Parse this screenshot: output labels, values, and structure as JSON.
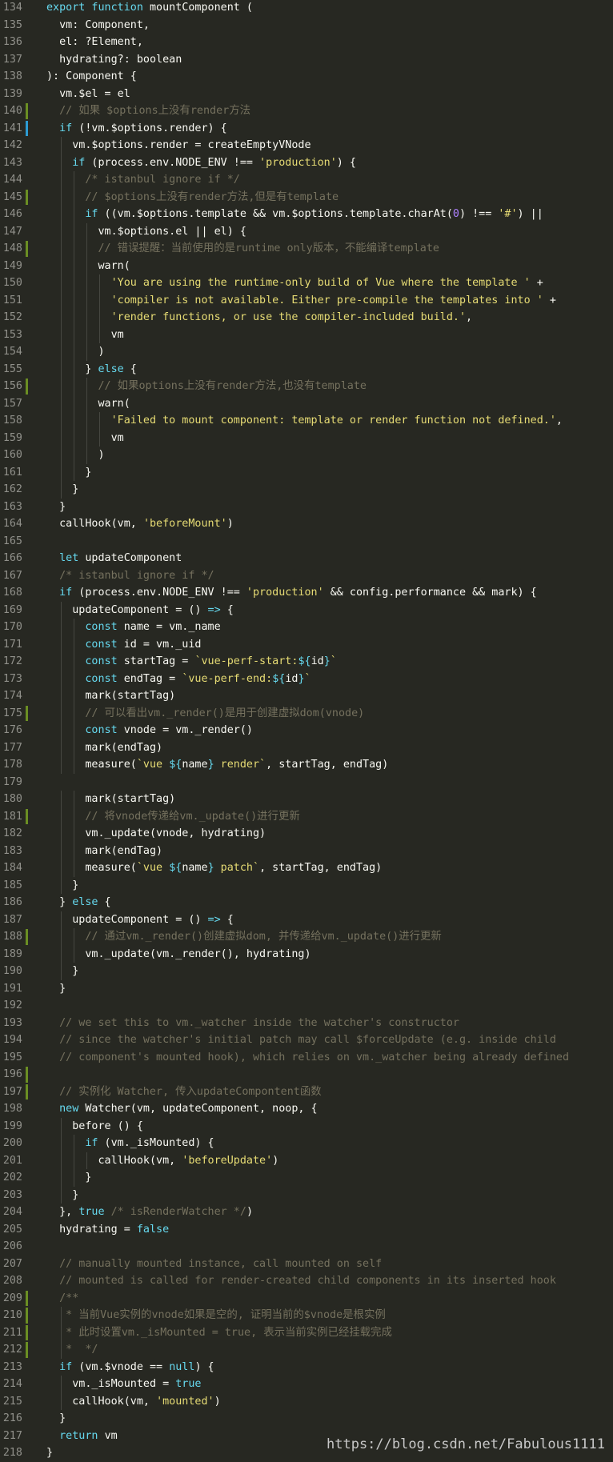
{
  "editor": {
    "background": "#272822",
    "colors": {
      "keyword": "#66d9ef",
      "string": "#e6db74",
      "comment": "#75715e",
      "number": "#ae81ff",
      "text": "#f8f8f2",
      "gutter_modified": "#6b8e23",
      "gutter_changed": "#2d9bd2"
    },
    "lines": [
      {
        "n": "134",
        "g": "",
        "t": [
          [
            "kw",
            "export function "
          ],
          [
            "",
            "mountComponent ("
          ]
        ]
      },
      {
        "n": "135",
        "g": "",
        "t": [
          [
            "",
            "  vm: Component,"
          ]
        ]
      },
      {
        "n": "136",
        "g": "",
        "t": [
          [
            "",
            "  el: ?Element,"
          ]
        ]
      },
      {
        "n": "137",
        "g": "",
        "t": [
          [
            "",
            "  hydrating?: boolean"
          ]
        ]
      },
      {
        "n": "138",
        "g": "",
        "t": [
          [
            "",
            "): Component {"
          ]
        ]
      },
      {
        "n": "139",
        "g": "",
        "t": [
          [
            "",
            "  vm.$el = el"
          ]
        ]
      },
      {
        "n": "140",
        "g": "mod",
        "t": [
          [
            "cm",
            "  // 如果 $options上没有render方法"
          ]
        ]
      },
      {
        "n": "141",
        "g": "chg",
        "t": [
          [
            "kw",
            "  if"
          ],
          [
            "",
            " (!vm.$options.render) {"
          ]
        ]
      },
      {
        "n": "142",
        "g": "",
        "t": [
          [
            "",
            "    vm.$options.render = createEmptyVNode"
          ]
        ]
      },
      {
        "n": "143",
        "g": "",
        "t": [
          [
            "kw",
            "    if"
          ],
          [
            "",
            " (process.env.NODE_ENV !== "
          ],
          [
            "str",
            "'production'"
          ],
          [
            "",
            ") {"
          ]
        ]
      },
      {
        "n": "144",
        "g": "",
        "t": [
          [
            "cm",
            "      /* istanbul ignore if */"
          ]
        ]
      },
      {
        "n": "145",
        "g": "mod",
        "t": [
          [
            "cm",
            "      // $options上没有render方法,但是有template"
          ]
        ]
      },
      {
        "n": "146",
        "g": "",
        "t": [
          [
            "kw",
            "      if"
          ],
          [
            "",
            " ((vm.$options.template && vm.$options.template.charAt("
          ],
          [
            "num",
            "0"
          ],
          [
            "",
            ") !== "
          ],
          [
            "str",
            "'#'"
          ],
          [
            "",
            ") ||"
          ]
        ]
      },
      {
        "n": "147",
        "g": "",
        "t": [
          [
            "",
            "        vm.$options.el || el) {"
          ]
        ]
      },
      {
        "n": "148",
        "g": "mod",
        "t": [
          [
            "cm",
            "        // 错误提醒：当前使用的是runtime only版本，不能编译template"
          ]
        ]
      },
      {
        "n": "149",
        "g": "",
        "t": [
          [
            "",
            "        warn("
          ]
        ]
      },
      {
        "n": "150",
        "g": "",
        "t": [
          [
            "str",
            "          'You are using the runtime-only build of Vue where the template '"
          ],
          [
            "",
            " +"
          ]
        ]
      },
      {
        "n": "151",
        "g": "",
        "t": [
          [
            "str",
            "          'compiler is not available. Either pre-compile the templates into '"
          ],
          [
            "",
            " +"
          ]
        ]
      },
      {
        "n": "152",
        "g": "",
        "t": [
          [
            "str",
            "          'render functions, or use the compiler-included build.'"
          ],
          [
            "",
            ","
          ]
        ]
      },
      {
        "n": "153",
        "g": "",
        "t": [
          [
            "",
            "          vm"
          ]
        ]
      },
      {
        "n": "154",
        "g": "",
        "t": [
          [
            "",
            "        )"
          ]
        ]
      },
      {
        "n": "155",
        "g": "",
        "t": [
          [
            "",
            "      } "
          ],
          [
            "kw",
            "else"
          ],
          [
            "",
            " {"
          ]
        ]
      },
      {
        "n": "156",
        "g": "mod",
        "t": [
          [
            "cm",
            "        // 如果options上没有render方法,也没有template"
          ]
        ]
      },
      {
        "n": "157",
        "g": "",
        "t": [
          [
            "",
            "        warn("
          ]
        ]
      },
      {
        "n": "158",
        "g": "",
        "t": [
          [
            "str",
            "          'Failed to mount component: template or render function not defined.'"
          ],
          [
            "",
            ","
          ]
        ]
      },
      {
        "n": "159",
        "g": "",
        "t": [
          [
            "",
            "          vm"
          ]
        ]
      },
      {
        "n": "160",
        "g": "",
        "t": [
          [
            "",
            "        )"
          ]
        ]
      },
      {
        "n": "161",
        "g": "",
        "t": [
          [
            "",
            "      }"
          ]
        ]
      },
      {
        "n": "162",
        "g": "",
        "t": [
          [
            "",
            "    }"
          ]
        ]
      },
      {
        "n": "163",
        "g": "",
        "t": [
          [
            "",
            "  }"
          ]
        ]
      },
      {
        "n": "164",
        "g": "",
        "t": [
          [
            "",
            "  callHook(vm, "
          ],
          [
            "str",
            "'beforeMount'"
          ],
          [
            "",
            ")"
          ]
        ]
      },
      {
        "n": "165",
        "g": "",
        "t": []
      },
      {
        "n": "166",
        "g": "",
        "t": [
          [
            "kw",
            "  let "
          ],
          [
            "",
            "updateComponent"
          ]
        ]
      },
      {
        "n": "167",
        "g": "",
        "t": [
          [
            "cm",
            "  /* istanbul ignore if */"
          ]
        ]
      },
      {
        "n": "168",
        "g": "",
        "t": [
          [
            "kw",
            "  if"
          ],
          [
            "",
            " (process.env.NODE_ENV !== "
          ],
          [
            "str",
            "'production'"
          ],
          [
            "",
            " && config.performance && mark) {"
          ]
        ]
      },
      {
        "n": "169",
        "g": "",
        "t": [
          [
            "",
            "    updateComponent = () "
          ],
          [
            "kw",
            "=>"
          ],
          [
            "",
            " {"
          ]
        ]
      },
      {
        "n": "170",
        "g": "",
        "t": [
          [
            "kw",
            "      const "
          ],
          [
            "",
            "name = vm._name"
          ]
        ]
      },
      {
        "n": "171",
        "g": "",
        "t": [
          [
            "kw",
            "      const "
          ],
          [
            "",
            "id = vm._uid"
          ]
        ]
      },
      {
        "n": "172",
        "g": "",
        "t": [
          [
            "kw",
            "      const "
          ],
          [
            "",
            "startTag = "
          ],
          [
            "str",
            "`vue-perf-start:"
          ],
          [
            "kw",
            "${"
          ],
          [
            "",
            "id"
          ],
          [
            "kw",
            "}"
          ],
          [
            "str",
            "`"
          ]
        ]
      },
      {
        "n": "173",
        "g": "",
        "t": [
          [
            "kw",
            "      const "
          ],
          [
            "",
            "endTag = "
          ],
          [
            "str",
            "`vue-perf-end:"
          ],
          [
            "kw",
            "${"
          ],
          [
            "",
            "id"
          ],
          [
            "kw",
            "}"
          ],
          [
            "str",
            "`"
          ]
        ]
      },
      {
        "n": "174",
        "g": "",
        "t": [
          [
            "",
            "      mark(startTag)"
          ]
        ]
      },
      {
        "n": "175",
        "g": "mod",
        "t": [
          [
            "cm",
            "      // 可以看出vm._render()是用于创建虚拟dom(vnode)"
          ]
        ]
      },
      {
        "n": "176",
        "g": "",
        "t": [
          [
            "kw",
            "      const "
          ],
          [
            "",
            "vnode = vm._render()"
          ]
        ]
      },
      {
        "n": "177",
        "g": "",
        "t": [
          [
            "",
            "      mark(endTag)"
          ]
        ]
      },
      {
        "n": "178",
        "g": "",
        "t": [
          [
            "",
            "      measure("
          ],
          [
            "str",
            "`vue "
          ],
          [
            "kw",
            "${"
          ],
          [
            "",
            "name"
          ],
          [
            "kw",
            "}"
          ],
          [
            "str",
            " render`"
          ],
          [
            "",
            ", startTag, endTag)"
          ]
        ]
      },
      {
        "n": "179",
        "g": "",
        "t": []
      },
      {
        "n": "180",
        "g": "",
        "t": [
          [
            "",
            "      mark(startTag)"
          ]
        ]
      },
      {
        "n": "181",
        "g": "mod",
        "t": [
          [
            "cm",
            "      // 将vnode传递给vm._update()进行更新"
          ]
        ]
      },
      {
        "n": "182",
        "g": "",
        "t": [
          [
            "",
            "      vm._update(vnode, hydrating)"
          ]
        ]
      },
      {
        "n": "183",
        "g": "",
        "t": [
          [
            "",
            "      mark(endTag)"
          ]
        ]
      },
      {
        "n": "184",
        "g": "",
        "t": [
          [
            "",
            "      measure("
          ],
          [
            "str",
            "`vue "
          ],
          [
            "kw",
            "${"
          ],
          [
            "",
            "name"
          ],
          [
            "kw",
            "}"
          ],
          [
            "str",
            " patch`"
          ],
          [
            "",
            ", startTag, endTag)"
          ]
        ]
      },
      {
        "n": "185",
        "g": "",
        "t": [
          [
            "",
            "    }"
          ]
        ]
      },
      {
        "n": "186",
        "g": "",
        "t": [
          [
            "",
            "  } "
          ],
          [
            "kw",
            "else"
          ],
          [
            "",
            " {"
          ]
        ]
      },
      {
        "n": "187",
        "g": "",
        "t": [
          [
            "",
            "    updateComponent = () "
          ],
          [
            "kw",
            "=>"
          ],
          [
            "",
            " {"
          ]
        ]
      },
      {
        "n": "188",
        "g": "mod",
        "t": [
          [
            "cm",
            "      // 通过vm._render()创建虚拟dom, 并传递给vm._update()进行更新"
          ]
        ]
      },
      {
        "n": "189",
        "g": "",
        "t": [
          [
            "",
            "      vm._update(vm._render(), hydrating)"
          ]
        ]
      },
      {
        "n": "190",
        "g": "",
        "t": [
          [
            "",
            "    }"
          ]
        ]
      },
      {
        "n": "191",
        "g": "",
        "t": [
          [
            "",
            "  }"
          ]
        ]
      },
      {
        "n": "192",
        "g": "",
        "t": []
      },
      {
        "n": "193",
        "g": "",
        "t": [
          [
            "cm",
            "  // we set this to vm._watcher inside the watcher's constructor"
          ]
        ]
      },
      {
        "n": "194",
        "g": "",
        "t": [
          [
            "cm",
            "  // since the watcher's initial patch may call $forceUpdate (e.g. inside child"
          ]
        ]
      },
      {
        "n": "195",
        "g": "",
        "t": [
          [
            "cm",
            "  // component's mounted hook), which relies on vm._watcher being already defined"
          ]
        ]
      },
      {
        "n": "196",
        "g": "mod",
        "t": []
      },
      {
        "n": "197",
        "g": "mod",
        "t": [
          [
            "cm",
            "  // 实例化 Watcher, 传入updateCompontent函数"
          ]
        ]
      },
      {
        "n": "198",
        "g": "",
        "t": [
          [
            "kw",
            "  new "
          ],
          [
            "",
            "Watcher(vm, updateComponent, noop, {"
          ]
        ]
      },
      {
        "n": "199",
        "g": "",
        "t": [
          [
            "",
            "    before () {"
          ]
        ]
      },
      {
        "n": "200",
        "g": "",
        "t": [
          [
            "kw",
            "      if"
          ],
          [
            "",
            " (vm._isMounted) {"
          ]
        ]
      },
      {
        "n": "201",
        "g": "",
        "t": [
          [
            "",
            "        callHook(vm, "
          ],
          [
            "str",
            "'beforeUpdate'"
          ],
          [
            "",
            ")"
          ]
        ]
      },
      {
        "n": "202",
        "g": "",
        "t": [
          [
            "",
            "      }"
          ]
        ]
      },
      {
        "n": "203",
        "g": "",
        "t": [
          [
            "",
            "    }"
          ]
        ]
      },
      {
        "n": "204",
        "g": "",
        "t": [
          [
            "",
            "  }, "
          ],
          [
            "kw",
            "true "
          ],
          [
            "cm",
            "/* isRenderWatcher */"
          ],
          [
            "",
            ")"
          ]
        ]
      },
      {
        "n": "205",
        "g": "",
        "t": [
          [
            "",
            "  hydrating = "
          ],
          [
            "kw",
            "false"
          ]
        ]
      },
      {
        "n": "206",
        "g": "",
        "t": []
      },
      {
        "n": "207",
        "g": "",
        "t": [
          [
            "cm",
            "  // manually mounted instance, call mounted on self"
          ]
        ]
      },
      {
        "n": "208",
        "g": "",
        "t": [
          [
            "cm",
            "  // mounted is called for render-created child components in its inserted hook"
          ]
        ]
      },
      {
        "n": "209",
        "g": "mod",
        "t": [
          [
            "cm",
            "  /**"
          ]
        ]
      },
      {
        "n": "210",
        "g": "mod",
        "t": [
          [
            "cm",
            "   * 当前Vue实例的vnode如果是空的, 证明当前的$vnode是根实例"
          ]
        ]
      },
      {
        "n": "211",
        "g": "mod",
        "t": [
          [
            "cm",
            "   * 此时设置vm._isMounted = true, 表示当前实例已经挂载完成"
          ]
        ]
      },
      {
        "n": "212",
        "g": "mod",
        "t": [
          [
            "cm",
            "   *  */"
          ]
        ]
      },
      {
        "n": "213",
        "g": "",
        "t": [
          [
            "kw",
            "  if"
          ],
          [
            "",
            " (vm.$vnode == "
          ],
          [
            "kw",
            "null"
          ],
          [
            "",
            ") {"
          ]
        ]
      },
      {
        "n": "214",
        "g": "",
        "t": [
          [
            "",
            "    vm._isMounted = "
          ],
          [
            "kw",
            "true"
          ]
        ]
      },
      {
        "n": "215",
        "g": "",
        "t": [
          [
            "",
            "    callHook(vm, "
          ],
          [
            "str",
            "'mounted'"
          ],
          [
            "",
            ")"
          ]
        ]
      },
      {
        "n": "216",
        "g": "",
        "t": [
          [
            "",
            "  }"
          ]
        ]
      },
      {
        "n": "217",
        "g": "",
        "t": [
          [
            "kw",
            "  return "
          ],
          [
            "",
            "vm"
          ]
        ]
      },
      {
        "n": "218",
        "g": "",
        "t": [
          [
            "",
            "}"
          ]
        ]
      }
    ]
  },
  "watermark": "https://blog.csdn.net/Fabulous1111"
}
